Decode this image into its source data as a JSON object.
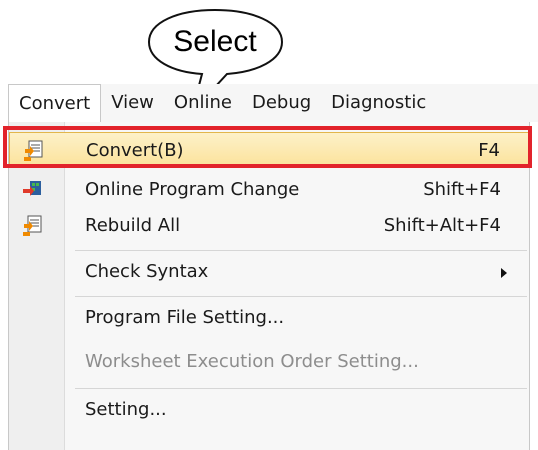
{
  "callout": {
    "text": "Select"
  },
  "menubar": {
    "items": [
      {
        "label": "Convert"
      },
      {
        "label": "View"
      },
      {
        "label": "Online"
      },
      {
        "label": "Debug"
      },
      {
        "label": "Diagnostic"
      }
    ]
  },
  "menu": {
    "items": [
      {
        "label": "Convert(B)",
        "shortcut": "F4",
        "icon": "convert-icon",
        "state": "highlighted"
      },
      {
        "label": "Online Program Change",
        "shortcut": "Shift+F4",
        "icon": "online-program-change-icon"
      },
      {
        "label": "Rebuild All",
        "shortcut": "Shift+Alt+F4",
        "icon": "rebuild-all-icon"
      },
      {
        "label": "Check Syntax",
        "has_submenu": true
      },
      {
        "label": "Program File Setting..."
      },
      {
        "label": "Worksheet Execution Order Setting...",
        "state": "disabled"
      },
      {
        "label": "Setting..."
      }
    ]
  },
  "colors": {
    "highlight_frame": "#e2232b",
    "highlight_fill": "#fbe29a",
    "disabled_text": "#8d8d8d"
  }
}
